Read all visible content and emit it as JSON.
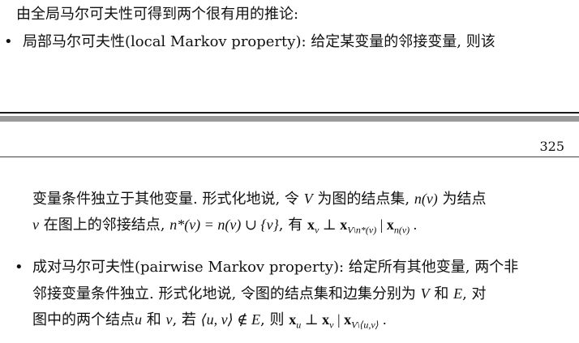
{
  "top": {
    "intro": "由全局马尔可夫性可得到两个很有用的推论:",
    "bullet1": "局部马尔可夫性(local Markov property): 给定某变量的邻接变量, 则该"
  },
  "page_number": "325",
  "bottom": {
    "b1_cont_line1_a": "变量条件独立于其他变量. 形式化地说, 令",
    "b1_cont_line1_b": "为图的结点集,",
    "b1_cont_line1_c": "为结点",
    "b1_cont_line2_a": "在图上的邻接结点,",
    "b1_cont_line2_b": ", 有",
    "bullet2_line1": "成对马尔可夫性(pairwise Markov property): 给定所有其他变量, 两个非",
    "bullet2_line2_a": "邻接变量条件独立. 形式化地说, 令图的结点集和边集分别为",
    "bullet2_line2_b": "和",
    "bullet2_line2_c": ", 对",
    "bullet2_line3_a": "图中的两个结点",
    "bullet2_line3_b": "和",
    "bullet2_line3_c": ", 若",
    "bullet2_line3_d": ", 则"
  },
  "symbols": {
    "bullet": "•",
    "V": "V",
    "E": "E",
    "nv": "n(v)",
    "v": "v",
    "u": "u",
    "nstar_eq": "n*(v) = n(v) ∪ {v}",
    "angle_uv": "⟨u, v⟩ ∉ E",
    "x": "x",
    "perp": "⊥",
    "bar": "|",
    "sub_v": "v",
    "sub_u": "u",
    "sub_V_nstar": "V\\n*(v)",
    "sub_nv": "n(v)",
    "sub_V_uv": "V\\⟨u,v⟩",
    "period": "."
  }
}
